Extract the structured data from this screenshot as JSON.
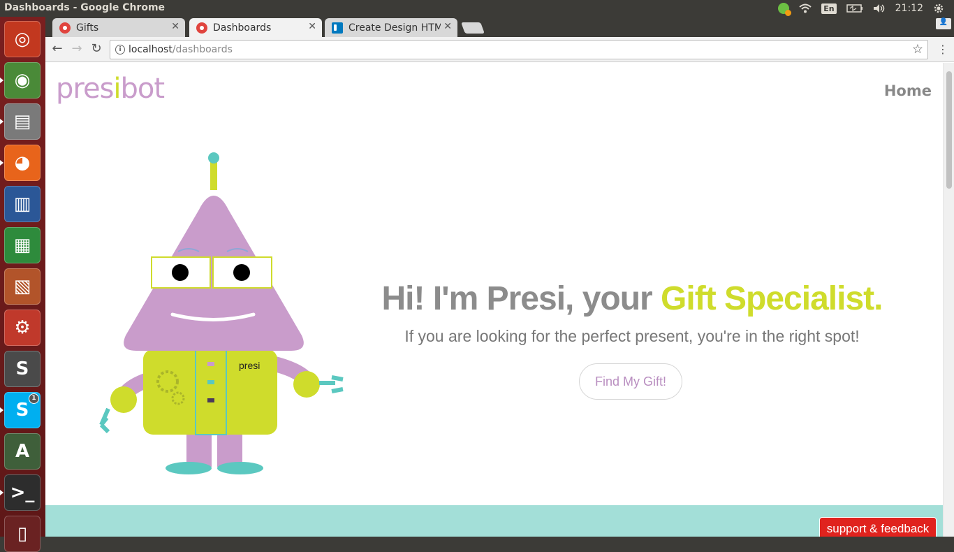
{
  "panel": {
    "window_title": "Dashboards - Google Chrome",
    "keyboard_layout": "En",
    "clock": "21:12"
  },
  "launcher": {
    "items": [
      {
        "name": "ubuntu-dash",
        "color": "#c2381f"
      },
      {
        "name": "chrome",
        "color": "#4a8a38"
      },
      {
        "name": "files",
        "color": "#7a7a7a"
      },
      {
        "name": "firefox",
        "color": "#e8641b"
      },
      {
        "name": "writer",
        "color": "#2b5797"
      },
      {
        "name": "calc",
        "color": "#2e8b3c"
      },
      {
        "name": "impress",
        "color": "#b2542a"
      },
      {
        "name": "system-settings",
        "color": "#c0392b"
      },
      {
        "name": "sublime-text",
        "color": "#4a4a4a"
      },
      {
        "name": "skype",
        "color": "#00aff0",
        "badge": "1"
      },
      {
        "name": "software-updater",
        "color": "#3f5f3a"
      },
      {
        "name": "terminal",
        "color": "#2d2d2d"
      },
      {
        "name": "trash",
        "color": "#6a2222"
      }
    ]
  },
  "browser": {
    "tabs": [
      {
        "label": "Gifts",
        "favicon": "presibot-icon"
      },
      {
        "label": "Dashboards",
        "favicon": "presibot-icon",
        "active": true
      },
      {
        "label": "Create Design HTM",
        "favicon": "trello-icon"
      }
    ],
    "url_host": "localhost",
    "url_path": "/dashboards"
  },
  "page": {
    "logo": {
      "pre": "pres",
      "i": "i",
      "post": "bot"
    },
    "nav_home": "Home",
    "hero_title_plain": "Hi! I'm Presi, your ",
    "hero_title_accent": "Gift Specialist.",
    "hero_subtitle": "If you are looking for the perfect present, you're in the right spot!",
    "cta_label": "Find My Gift!",
    "robot_label": "presi",
    "support_label": "support & feedback",
    "colors": {
      "purple": "#c99ccb",
      "lime": "#cfdc2c",
      "teal": "#5bc8c0",
      "band": "#a3dfd8",
      "support": "#e0231e"
    }
  }
}
